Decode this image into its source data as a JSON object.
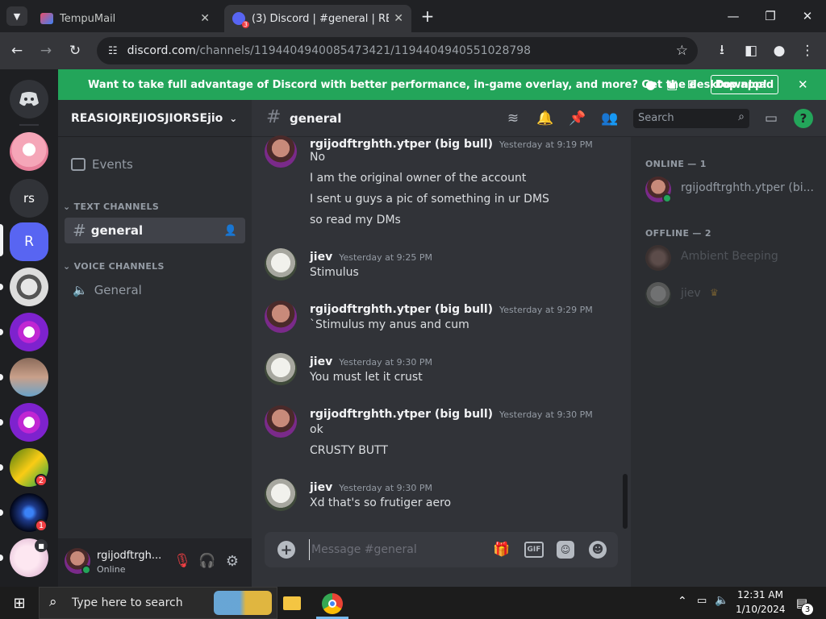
{
  "browser": {
    "tabs": [
      {
        "title": "TempuMail",
        "active": false
      },
      {
        "title": "(3) Discord | #general | REASIOJ",
        "active": false,
        "badge": "3"
      },
      {
        "title": "",
        "active": false
      }
    ],
    "new_tab": "+",
    "window_controls": {
      "minimize": "—",
      "restore": "❐",
      "close": "✕"
    },
    "url_host": "discord.com",
    "url_path": "/channels/1194404940085473421/1194404940551028798"
  },
  "banner": {
    "text": "Want to take full advantage of Discord with better performance, in-game overlay, and more? Get the desktop app!",
    "button": "Download",
    "bg": "#23a55a"
  },
  "guilds": {
    "items": [
      {
        "label": "rs"
      },
      {
        "label": "R"
      }
    ],
    "badges": [
      "2",
      "1"
    ]
  },
  "server": {
    "name": "REASIOJREJIOSJIORSEjio",
    "events": "Events",
    "text_category": "TEXT CHANNELS",
    "text_channel": "general",
    "voice_category": "VOICE CHANNELS",
    "voice_channel": "General"
  },
  "user": {
    "name": "rgijodftrgh...",
    "status": "Online"
  },
  "chat": {
    "channel": "general",
    "search_placeholder": "Search",
    "composer_placeholder": "Message #general",
    "messages": [
      {
        "author": "rgijodftrghth.ytper (big bull)",
        "time": "Yesterday at 9:19 PM",
        "lines": [
          "No",
          "I am the original owner of the account",
          "I sent u guys a pic of something in ur DMS",
          "so read my DMs"
        ]
      },
      {
        "author": "jiev",
        "time": "Yesterday at 9:25 PM",
        "lines": [
          "Stimulus"
        ]
      },
      {
        "author": "rgijodftrghth.ytper (big bull)",
        "time": "Yesterday at 9:29 PM",
        "lines": [
          "`Stimulus my anus and cum"
        ]
      },
      {
        "author": "jiev",
        "time": "Yesterday at 9:30 PM",
        "lines": [
          "You must let it crust"
        ]
      },
      {
        "author": "rgijodftrghth.ytper (big bull)",
        "time": "Yesterday at 9:30 PM",
        "lines": [
          "ok",
          "CRUSTY BUTT"
        ]
      },
      {
        "author": "jiev",
        "time": "Yesterday at 9:30 PM",
        "lines": [
          "Xd that's so frutiger aero"
        ]
      }
    ]
  },
  "members": {
    "online_header": "ONLINE — 1",
    "online": [
      "rgijodftrghth.ytper (bi..."
    ],
    "offline_header": "OFFLINE — 2",
    "offline": [
      "Ambient Beeping",
      "jiev"
    ]
  },
  "taskbar": {
    "search": "Type here to search",
    "time": "12:31 AM",
    "date": "1/10/2024",
    "notif_count": "3"
  }
}
